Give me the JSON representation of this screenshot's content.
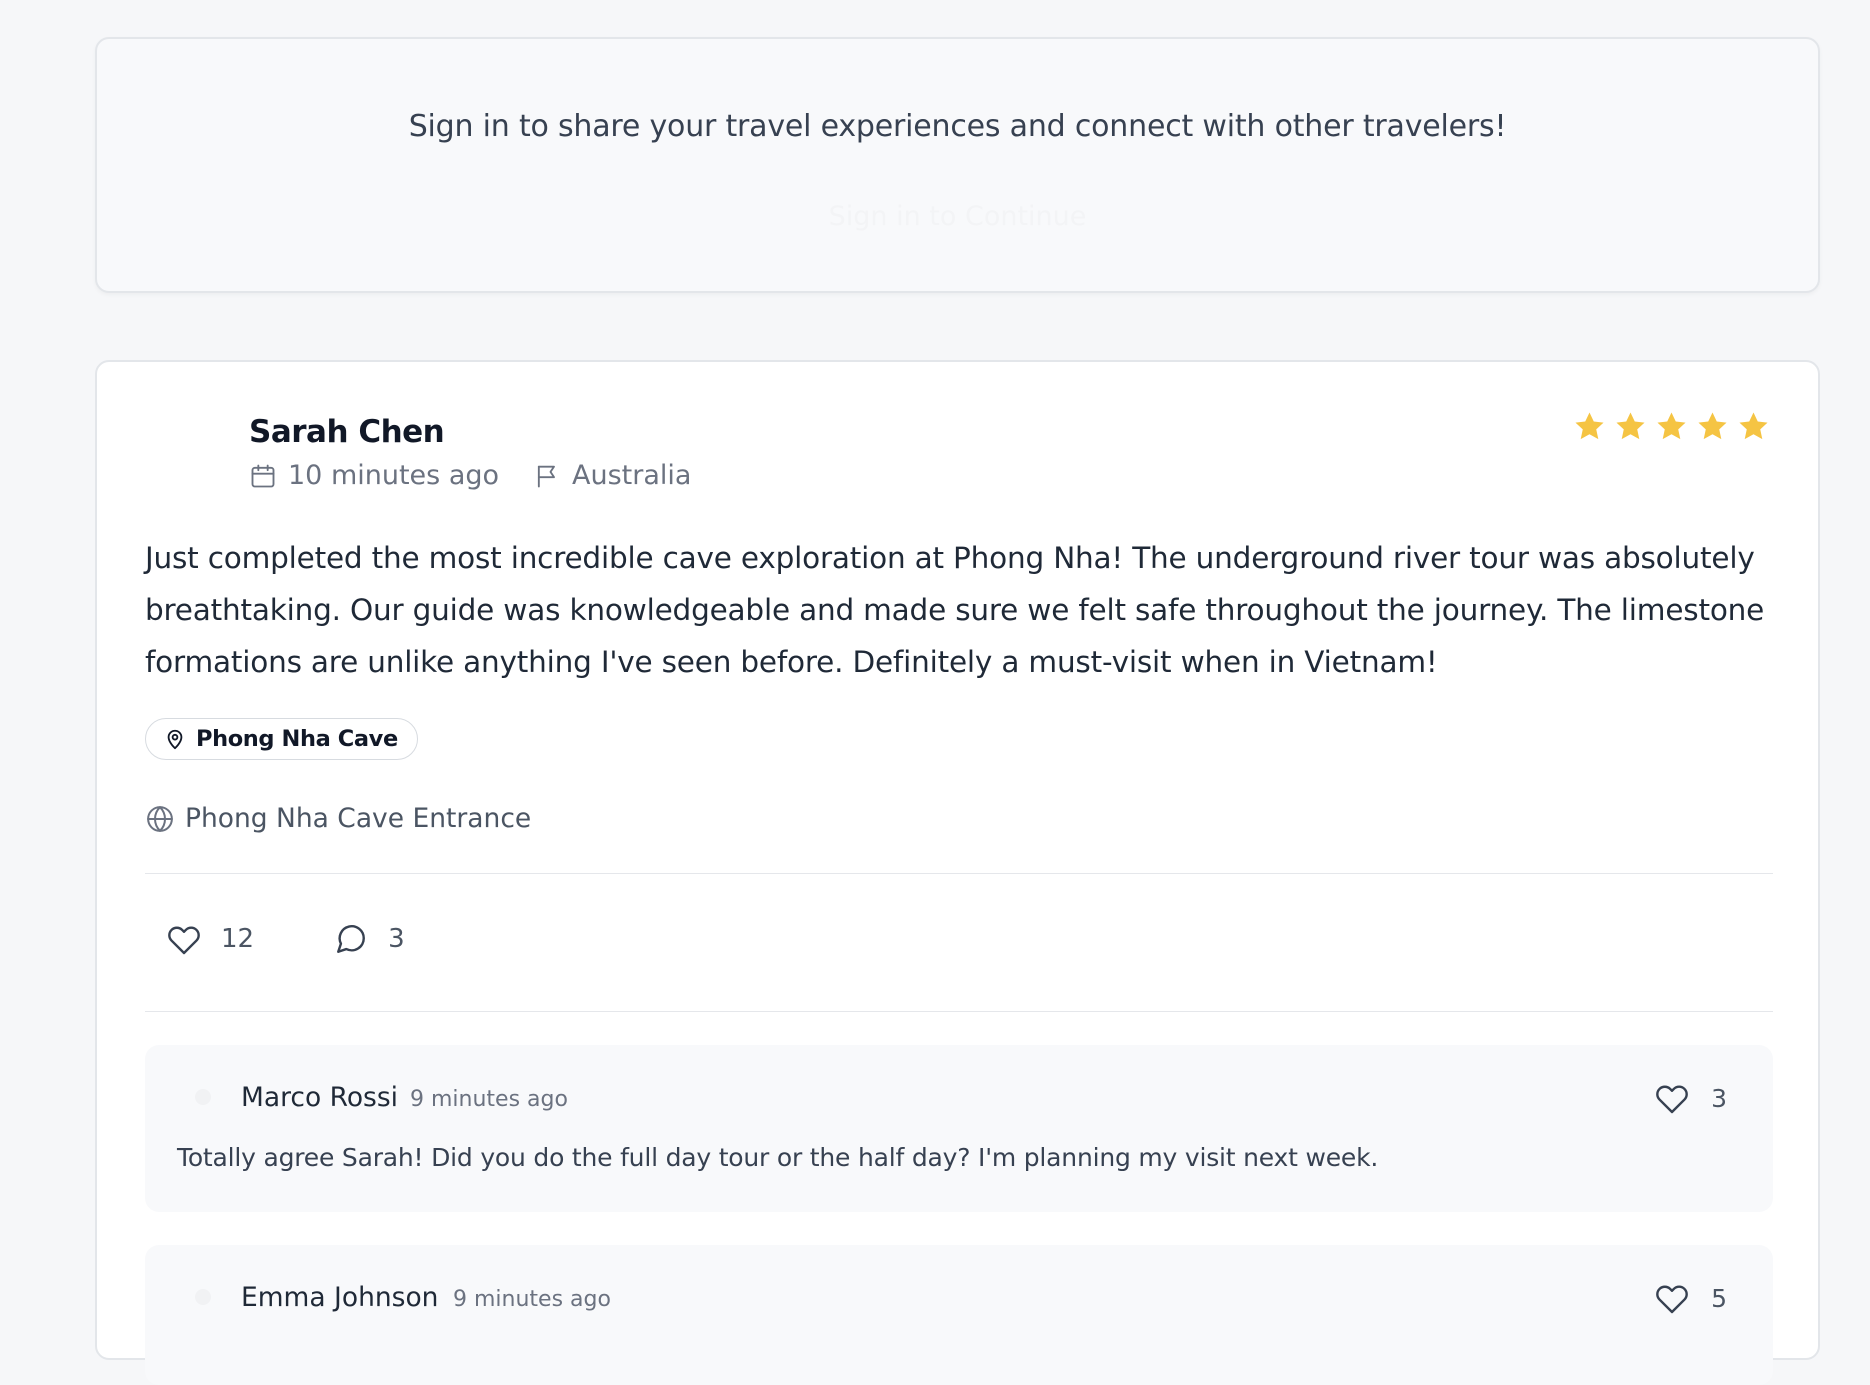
{
  "signin": {
    "message": "Sign in to share your travel experiences and connect with other travelers!",
    "button_label": "Sign in to Continue"
  },
  "post": {
    "author": "Sarah Chen",
    "time": "10 minutes ago",
    "country": "Australia",
    "rating": 5,
    "rating_max": 5,
    "body": "Just completed the most incredible cave exploration at Phong Nha! The underground river tour was absolutely breathtaking. Our guide was knowledgeable and made sure we felt safe throughout the journey. The limestone formations are unlike anything I've seen before. Definitely a must-visit when in Vietnam!",
    "tag": "Phong Nha Cave",
    "location": "Phong Nha Cave Entrance",
    "likes": "12",
    "comments_count": "3"
  },
  "comments": [
    {
      "author": "Marco Rossi",
      "time": "9 minutes ago",
      "likes": "3",
      "text": "Totally agree Sarah! Did you do the full day tour or the half day? I'm planning my visit next week."
    },
    {
      "author": "Emma Johnson",
      "time": "9 minutes ago",
      "likes": "5"
    }
  ],
  "colors": {
    "star": "#f5c443",
    "background": "#f6f7f9",
    "card_border": "#e3e6ea"
  },
  "icons": {
    "time": "calendar-icon",
    "country": "flag-icon",
    "tag": "map-pin-icon",
    "location": "globe-icon",
    "like": "heart-icon",
    "comment": "message-circle-icon"
  }
}
